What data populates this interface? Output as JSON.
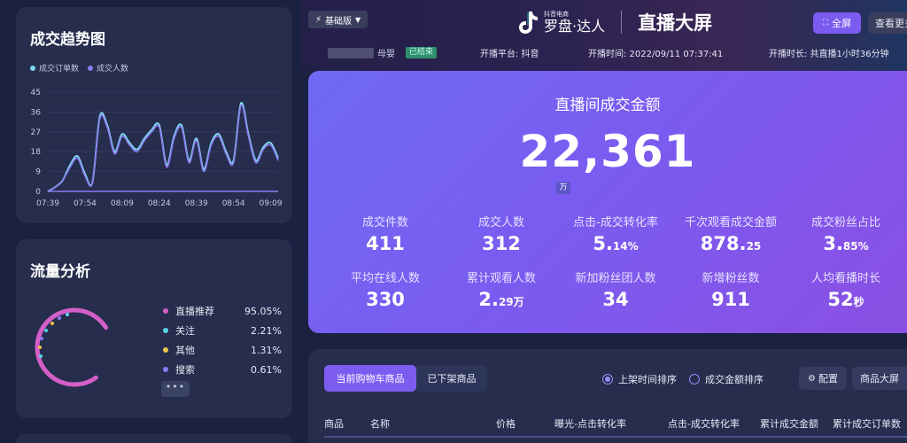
{
  "trend": {
    "title": "成交趋势图",
    "legend": [
      {
        "name": "成交订单数",
        "color": "#7fd6f0"
      },
      {
        "name": "成交人数",
        "color": "#8a7cf0"
      }
    ]
  },
  "chart_data": {
    "type": "line",
    "x": [
      "07:39",
      "07:42",
      "07:45",
      "07:48",
      "07:51",
      "07:54",
      "07:57",
      "08:00",
      "08:03",
      "08:06",
      "08:09",
      "08:12",
      "08:15",
      "08:18",
      "08:21",
      "08:24",
      "08:27",
      "08:30",
      "08:33",
      "08:36",
      "08:39",
      "08:42",
      "08:45",
      "08:48",
      "08:51",
      "08:54",
      "08:57",
      "09:00",
      "09:03",
      "09:06",
      "09:09",
      "09:12"
    ],
    "xticks": [
      "07:39",
      "07:54",
      "08:09",
      "08:24",
      "08:39",
      "08:54",
      "09:09"
    ],
    "yticks": [
      0,
      9,
      18,
      27,
      36,
      45
    ],
    "ylim": [
      0,
      45
    ],
    "series": [
      {
        "name": "成交订单数",
        "color": "#7fd6f0",
        "values": [
          0,
          2,
          5,
          12,
          16,
          8,
          4,
          34,
          30,
          18,
          26,
          22,
          19,
          24,
          28,
          30,
          12,
          25,
          30,
          14,
          24,
          10,
          22,
          26,
          18,
          14,
          40,
          26,
          14,
          20,
          22,
          15
        ]
      },
      {
        "name": "成交人数",
        "color": "#8a7cf0",
        "values": [
          0,
          2,
          5,
          11,
          15,
          7,
          4,
          33,
          29,
          17,
          25,
          21,
          18,
          23,
          27,
          29,
          11,
          24,
          29,
          13,
          23,
          9,
          21,
          25,
          17,
          13,
          39,
          25,
          13,
          19,
          21,
          14
        ]
      }
    ],
    "title": "",
    "xlabel": "",
    "ylabel": "",
    "grid": true,
    "legend": "top-left"
  },
  "traffic": {
    "title": "流量分析",
    "items": [
      {
        "name": "直播推荐",
        "value": "95.05%",
        "color": "#d45fc8"
      },
      {
        "name": "关注",
        "value": "2.21%",
        "color": "#58d3ea"
      },
      {
        "name": "其他",
        "value": "1.31%",
        "color": "#f0c34a"
      },
      {
        "name": "搜索",
        "value": "0.61%",
        "color": "#8a7cf0"
      }
    ],
    "more": "•••"
  },
  "header": {
    "version": "基础版",
    "logo_small": "抖音电商",
    "logo_text": "罗盘·达人",
    "screen_title": "直播大屏",
    "fullscreen": "全屏",
    "view_more": "查看更多"
  },
  "info": {
    "streamer": "母婴",
    "status": "已结束",
    "platform": "开播平台: 抖音",
    "start_time": "开播时间: 2022/09/11 07:37:41",
    "duration": "开播时长: 共直播1小时36分钟"
  },
  "gmv": {
    "title": "直播间成交金额",
    "value": "22,361",
    "unit": "万"
  },
  "metrics": [
    {
      "label": "成交件数",
      "value": "411",
      "suffix": ""
    },
    {
      "label": "成交人数",
      "value": "312",
      "suffix": ""
    },
    {
      "label": "点击-成交转化率",
      "value": "5.",
      "suffix": "14%"
    },
    {
      "label": "千次观看成交金额",
      "value": "878.",
      "suffix": "25"
    },
    {
      "label": "成交粉丝占比",
      "value": "3.",
      "suffix": "85%"
    },
    {
      "label": "平均在线人数",
      "value": "330",
      "suffix": ""
    },
    {
      "label": "累计观看人数",
      "value": "2.",
      "suffix": "29万"
    },
    {
      "label": "新加粉丝团人数",
      "value": "34",
      "suffix": ""
    },
    {
      "label": "新增粉丝数",
      "value": "911",
      "suffix": ""
    },
    {
      "label": "人均看播时长",
      "value": "52",
      "suffix": "秒"
    }
  ],
  "products": {
    "tab_current": "当前购物车商品",
    "tab_off": "已下架商品",
    "sort_time": "上架时间排序",
    "sort_amount": "成交金额排序",
    "config": "配置",
    "screen": "商品大屏",
    "columns": [
      "商品",
      "名称",
      "价格",
      "曝光-点击转化率",
      "点击-成交转化率",
      "累计成交金额",
      "累计成交订单数"
    ]
  }
}
